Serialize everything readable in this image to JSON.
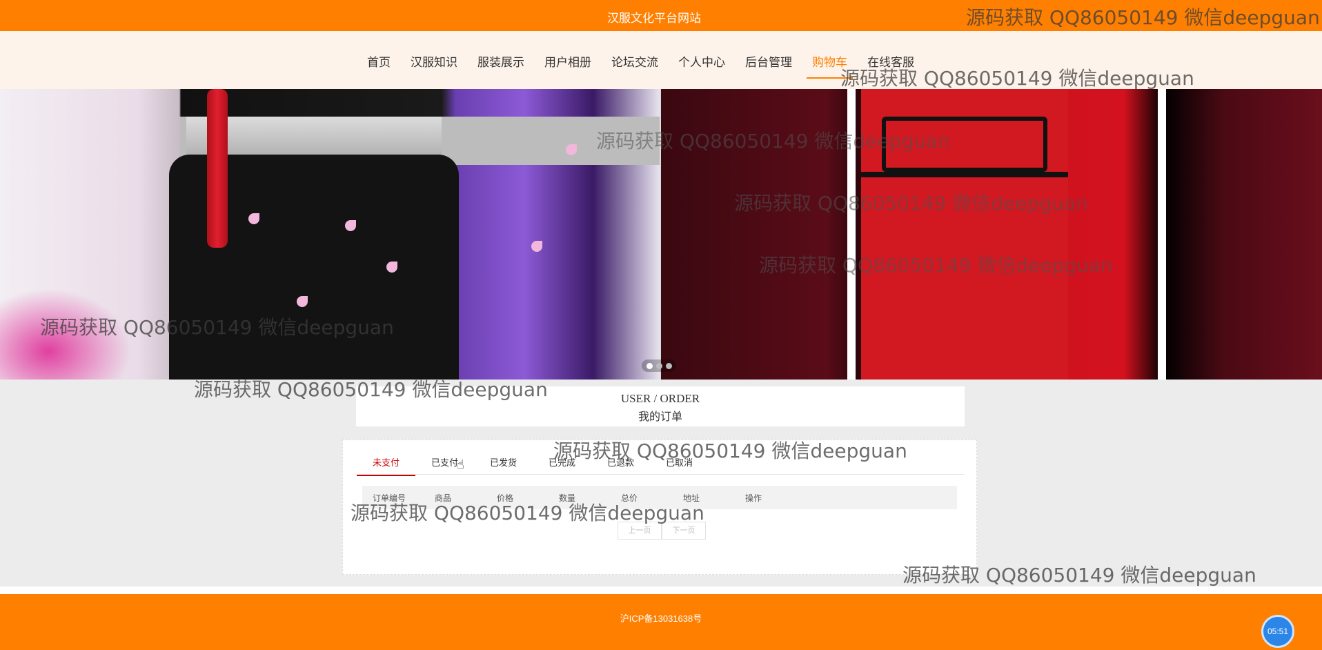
{
  "header": {
    "site_title": "汉服文化平台网站"
  },
  "nav": {
    "items": [
      {
        "label": "首页"
      },
      {
        "label": "汉服知识"
      },
      {
        "label": "服装展示"
      },
      {
        "label": "用户相册"
      },
      {
        "label": "论坛交流"
      },
      {
        "label": "个人中心"
      },
      {
        "label": "后台管理"
      },
      {
        "label": "购物车",
        "active": true
      },
      {
        "label": "在线客服"
      }
    ]
  },
  "banner": {
    "slides": 3,
    "active_slide": 1
  },
  "section": {
    "title_en": "USER / ORDER",
    "title_cn": "我的订单"
  },
  "orders": {
    "tabs": [
      {
        "label": "未支付",
        "active": true
      },
      {
        "label": "已支付"
      },
      {
        "label": "已发货"
      },
      {
        "label": "已完成"
      },
      {
        "label": "已退款"
      },
      {
        "label": "已取消"
      }
    ],
    "columns": [
      "订单编号",
      "商品",
      "价格",
      "数量",
      "总价",
      "地址",
      "操作"
    ],
    "rows": [],
    "pager": {
      "prev": "上一页",
      "next": "下一页"
    }
  },
  "footer": {
    "icp": "沪ICP备13031638号"
  },
  "clock": {
    "time": "05:51"
  },
  "watermark": "源码获取 QQ86050149 微信deepguan",
  "colors": {
    "brand": "#ff7f00",
    "active_tab": "#cc0000"
  }
}
